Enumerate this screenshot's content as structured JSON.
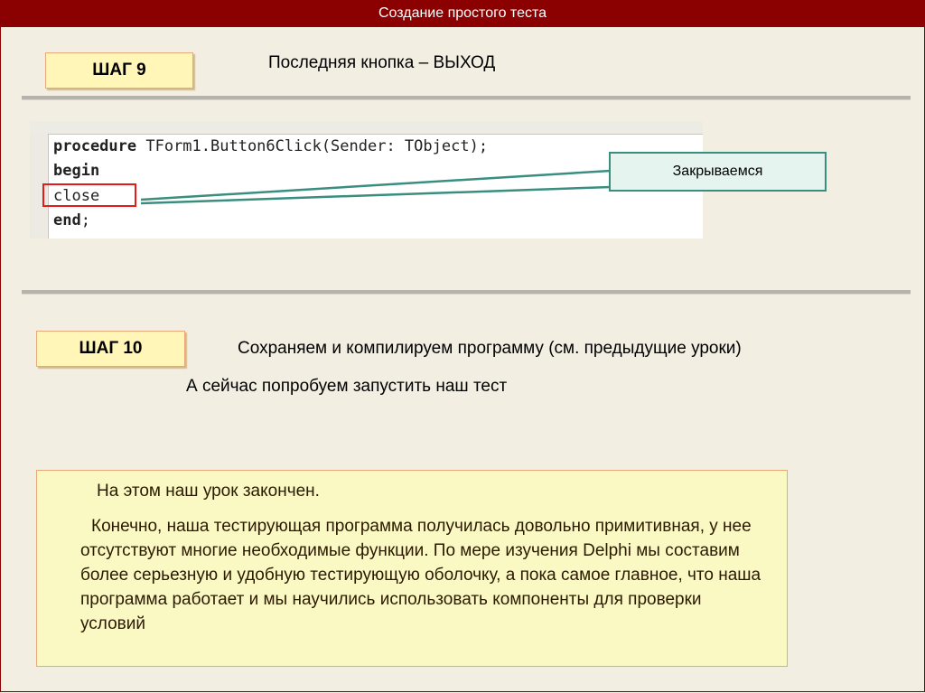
{
  "header": {
    "title": "Создание простого теста"
  },
  "step9": {
    "label": "ШАГ 9",
    "text": "Последняя кнопка –  ВЫХОД"
  },
  "code": {
    "line1_kw": "procedure",
    "line1_rest": " TForm1.Button6Click(Sender: TObject);",
    "line2_kw": "begin",
    "line3": "close",
    "line4_kw": "end",
    "line4_rest": ";"
  },
  "callout": {
    "text": "Закрываемся"
  },
  "step10": {
    "label": "ШАГ 10",
    "text": "Сохраняем и компилируем программу (см. предыдущие уроки)",
    "run_text": "А сейчас попробуем запустить наш тест"
  },
  "note": {
    "line1": "На этом наш урок закончен.",
    "body": "Конечно, наша тестирующая программа получилась довольно примитивная, у нее отсутствуют многие необходимые функции. По мере изучения Delphi мы составим более серьезную и удобную тестирующую оболочку, а пока самое главное, что наша программа работает и мы научились использовать компоненты для проверки условий"
  },
  "colors": {
    "title_bar": "#8b0000",
    "background": "#f2eee2",
    "step_box": "#fff6b8",
    "note_box": "#fbf9c3",
    "highlight": "#e31b1b",
    "callout_border": "#3a8e80"
  }
}
